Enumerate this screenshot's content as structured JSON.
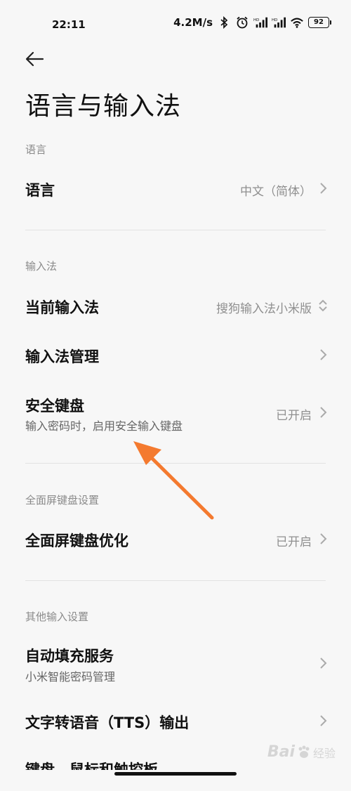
{
  "status_bar": {
    "time": "22:11",
    "net_speed": "4.2M/s",
    "battery": "92"
  },
  "page": {
    "title": "语言与输入法"
  },
  "sections": {
    "language": {
      "header": "语言",
      "rows": [
        {
          "title": "语言",
          "value": "中文（简体）"
        }
      ]
    },
    "input_method": {
      "header": "输入法",
      "rows": [
        {
          "title": "当前输入法",
          "value": "搜狗输入法小米版"
        },
        {
          "title": "输入法管理",
          "value": ""
        },
        {
          "title": "安全键盘",
          "subtitle": "输入密码时，启用安全输入键盘",
          "value": "已开启"
        }
      ]
    },
    "fullscreen_keyboard": {
      "header": "全面屏键盘设置",
      "rows": [
        {
          "title": "全面屏键盘优化",
          "value": "已开启"
        }
      ]
    },
    "other_input": {
      "header": "其他输入设置",
      "rows": [
        {
          "title": "自动填充服务",
          "subtitle": "小米智能密码管理",
          "value": ""
        },
        {
          "title": "文字转语音（TTS）输出",
          "value": ""
        },
        {
          "title": "键盘、鼠标和触控板",
          "value": ""
        }
      ]
    }
  },
  "watermark": {
    "brand": "Bai",
    "sub": "经验"
  },
  "colors": {
    "background": "#f7f7f7",
    "annotation_arrow": "#f47a2f"
  }
}
